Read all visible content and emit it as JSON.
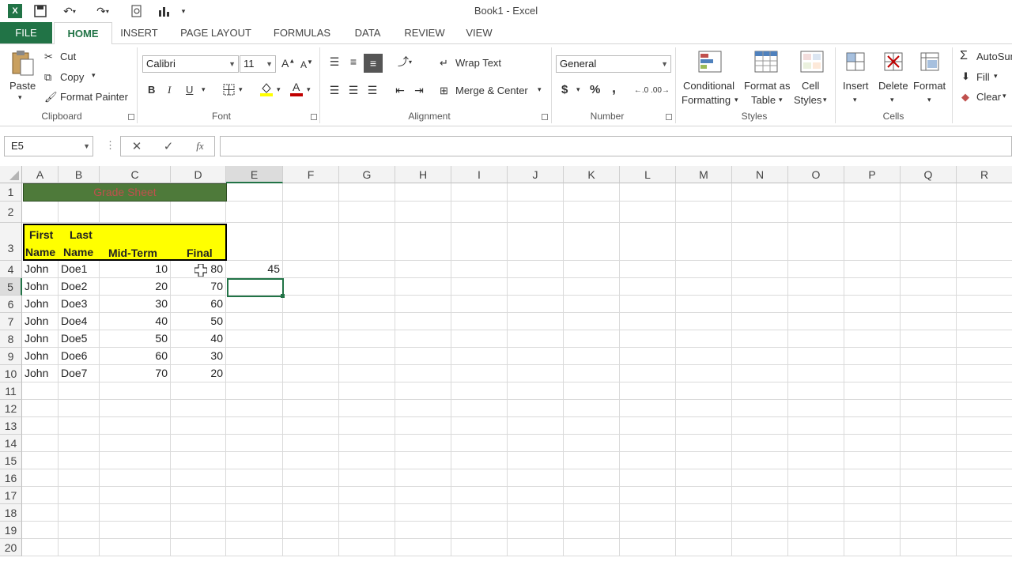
{
  "window": {
    "title": "Book1 - Excel"
  },
  "tabs": [
    "FILE",
    "HOME",
    "INSERT",
    "PAGE LAYOUT",
    "FORMULAS",
    "DATA",
    "REVIEW",
    "VIEW"
  ],
  "clipboard": {
    "paste": "Paste",
    "cut": "Cut",
    "copy": "Copy",
    "format_painter": "Format Painter",
    "label": "Clipboard"
  },
  "font": {
    "name": "Calibri",
    "size": "11",
    "label": "Font",
    "bold": "B",
    "italic": "I",
    "underline": "U"
  },
  "alignment": {
    "wrap_text": "Wrap Text",
    "merge_center": "Merge & Center",
    "label": "Alignment"
  },
  "number": {
    "format": "General",
    "currency": "$",
    "percent": "%",
    "comma": ",",
    "label": "Number"
  },
  "styles": {
    "conditional": "Conditional",
    "conditional2": "Formatting",
    "format_as": "Format as",
    "format_as2": "Table",
    "cell": "Cell",
    "cell2": "Styles",
    "label": "Styles"
  },
  "cells": {
    "insert": "Insert",
    "delete": "Delete",
    "format": "Format",
    "label": "Cells"
  },
  "editing": {
    "autosum": "AutoSum",
    "fill": "Fill",
    "clear": "Clear"
  },
  "formula_bar": {
    "name_box": "E5",
    "fx": "fx",
    "value": ""
  },
  "columns": [
    "A",
    "B",
    "C",
    "D",
    "E",
    "F",
    "G",
    "H",
    "I",
    "J",
    "K",
    "L",
    "M",
    "N",
    "O",
    "P",
    "Q",
    "R"
  ],
  "rows": [
    "1",
    "2",
    "3",
    "4",
    "5",
    "6",
    "7",
    "8",
    "9",
    "10",
    "11",
    "12",
    "13",
    "14",
    "15",
    "16",
    "17",
    "18",
    "19",
    "20"
  ],
  "sheet": {
    "title": "Grade Sheet",
    "headers": {
      "a1": "First",
      "a2": "Name",
      "b1": "Last",
      "b2": "Name",
      "c": "Mid-Term",
      "d": "Final"
    },
    "data": [
      [
        "John",
        "Doe1",
        "10",
        "80"
      ],
      [
        "John",
        "Doe2",
        "20",
        "70"
      ],
      [
        "John",
        "Doe3",
        "30",
        "60"
      ],
      [
        "John",
        "Doe4",
        "40",
        "50"
      ],
      [
        "John",
        "Doe5",
        "50",
        "40"
      ],
      [
        "John",
        "Doe6",
        "60",
        "30"
      ],
      [
        "John",
        "Doe7",
        "70",
        "20"
      ]
    ],
    "e4": "45",
    "selected_cell": "E5"
  },
  "colors": {
    "accent": "#217346",
    "title_fill": "#4e7a3a",
    "title_text": "#c0504d",
    "header_fill": "#ffff00"
  }
}
